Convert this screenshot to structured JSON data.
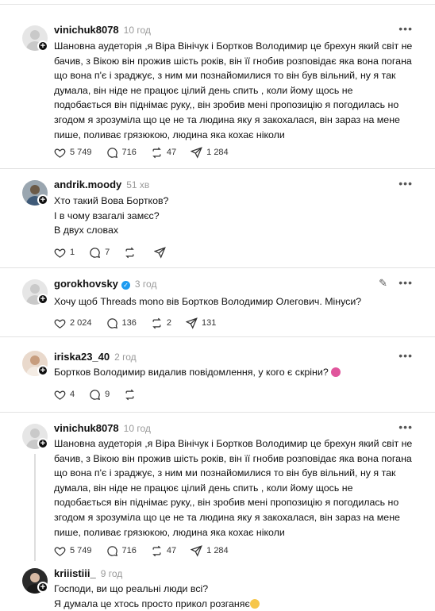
{
  "posts": [
    {
      "username": "vinichuk8078",
      "time": "10 год",
      "text": "Шановна аудеторія ,я Віра Вінічук і Бортков Володимир це брехун який світ не бачив, з Вікою він прожив шість років, він її гнобив розповідає яка вона погана що вона п'є і зраджує, з ним ми познайомилися то він був вільний, ну я так думала, він ніде не працює цілий день спить , коли йому щось не подобається він піднімає руку,, він зробив мені пропозицію я погодилась но згодом я зрозуміла що це не та людина яку я закохалася, він зараз на мене пише, поливає грязюкою, людина яка кохає ніколи",
      "likes": "5 749",
      "comments": "716",
      "reposts": "47",
      "shares": "1 284"
    },
    {
      "username": "andrik.moody",
      "time": "51 хв",
      "text": "Хто такий Вова Бортков?\nІ в чому взагалі замєс?\nВ двух словах",
      "likes": "1",
      "comments": "7",
      "reposts": "",
      "shares": ""
    },
    {
      "username": "gorokhovsky",
      "time": "3 год",
      "text": "Хочу щоб Threads mono вів Бортков Володимир Олегович. Мінуси?",
      "likes": "2 024",
      "comments": "136",
      "reposts": "2",
      "shares": "131"
    },
    {
      "username": "iriska23_40",
      "time": "2 год",
      "text": "Бортков Володимир видалив повідомлення, у кого є скріни?",
      "likes": "4",
      "comments": "9",
      "reposts": "",
      "shares": ""
    },
    {
      "username": "vinichuk8078",
      "time": "10 год",
      "text": "Шановна аудеторія ,я Віра Вінічук і Бортков Володимир це брехун який світ не бачив, з Вікою він прожив шість років, він її гнобив розповідає яка вона погана що вона п'є і зраджує, з ним ми познайомилися то він був вільний, ну я так думала, він ніде не працює цілий день спить , коли йому щось не подобається він піднімає руку,, він зробив мені пропозицію я погодилась но згодом я зрозуміла що це не та людина яку я закохалася, він зараз на мене пише, поливає грязюкою, людина яка кохає ніколи",
      "likes": "5 749",
      "comments": "716",
      "reposts": "47",
      "shares": "1 284"
    },
    {
      "username": "kriiistiii_",
      "time": "9 год",
      "text": "Господи, ви що реальні люди всі?\nЯ думала це хтось просто прикол розганяє",
      "likes": "",
      "comments": "",
      "reposts": "",
      "shares": ""
    }
  ],
  "more_glyph": "•••",
  "plus_glyph": "+",
  "verified_glyph": "✓",
  "edit_glyph": "✎",
  "colors": {
    "verified": "#1d9bf0",
    "text": "#101010",
    "muted": "#999999"
  }
}
